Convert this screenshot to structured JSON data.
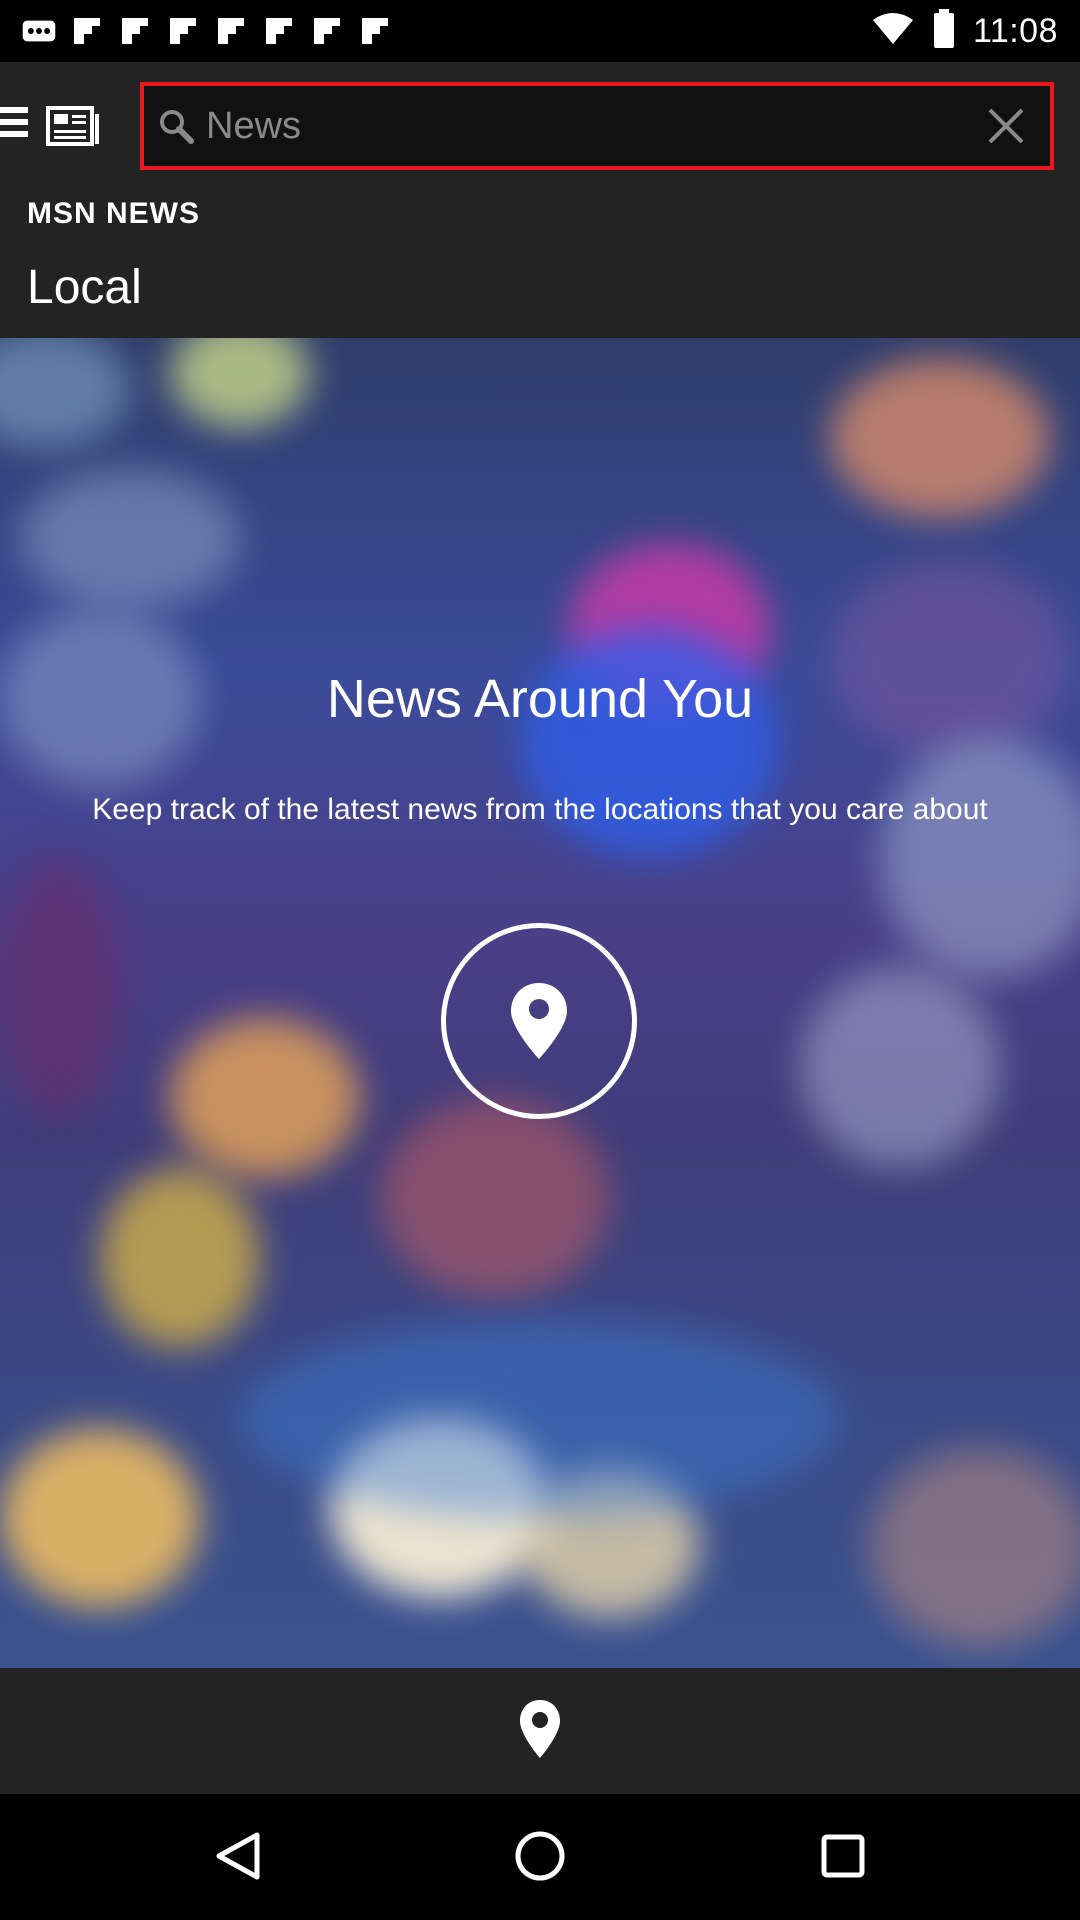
{
  "status_bar": {
    "time": "11:08",
    "icons": [
      "more-icon",
      "flipboard-icon",
      "flipboard-icon",
      "flipboard-icon",
      "flipboard-icon",
      "flipboard-icon",
      "flipboard-icon",
      "flipboard-icon",
      "wifi-icon",
      "battery-icon"
    ]
  },
  "header": {
    "search_placeholder": "News",
    "section_label": "MSN NEWS",
    "title": "Local"
  },
  "hero": {
    "title": "News Around You",
    "subtitle": "Keep track of the latest news from the locations that you care about"
  },
  "colors": {
    "header_bg": "#232323",
    "search_border": "#e8181d"
  }
}
